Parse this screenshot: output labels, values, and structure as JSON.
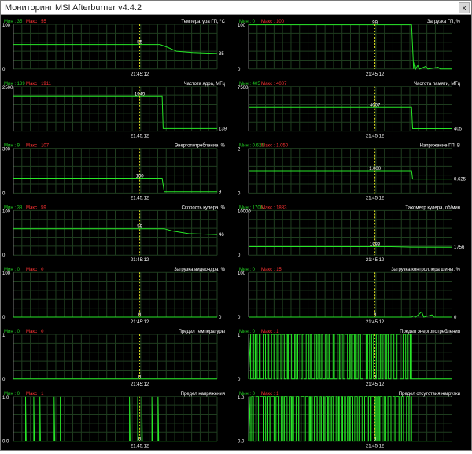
{
  "window": {
    "title": "Мониторинг MSI Afterburner v4.4.2",
    "close_label": "x"
  },
  "cursor_time": "21:45:12",
  "colors": {
    "background": "#000000",
    "grid": "#1f3d1f",
    "line": "#27e627",
    "stats_min": "#22cc22",
    "stats_max": "#ff3333",
    "cursor": "#e0e020",
    "text": "#ffffff"
  },
  "panels": [
    {
      "title": "Температура ГП, °C",
      "min_text": "Мин : 35",
      "max_text": "Макс : 55",
      "y_top": "100",
      "y_bottom": "0",
      "cursor_value": "55",
      "end_value": "35",
      "points": [
        [
          0,
          55
        ],
        [
          0.72,
          55
        ],
        [
          0.76,
          48
        ],
        [
          0.8,
          40
        ],
        [
          0.88,
          37
        ],
        [
          1,
          35
        ]
      ]
    },
    {
      "title": "Загрузка ГП, %",
      "min_text": "Мин : 0",
      "max_text": "Макс : 100",
      "y_top": "100",
      "y_bottom": "0",
      "cursor_value": "99",
      "end_value": "",
      "points": [
        [
          0,
          99
        ],
        [
          0.8,
          99
        ],
        [
          0.81,
          0
        ],
        [
          0.815,
          15
        ],
        [
          0.82,
          0
        ],
        [
          0.83,
          8
        ],
        [
          0.84,
          0
        ],
        [
          0.87,
          6
        ],
        [
          0.88,
          0
        ],
        [
          0.93,
          4
        ],
        [
          0.94,
          0
        ],
        [
          1,
          0
        ]
      ]
    },
    {
      "title": "Частота ядра, МГц",
      "min_text": "Мин : 139",
      "max_text": "Макс : 1911",
      "y_top": "2500",
      "y_bottom": "",
      "cursor_value": "1949",
      "end_value": "139",
      "points": [
        [
          0,
          1949
        ],
        [
          0.73,
          1949
        ],
        [
          0.735,
          139
        ],
        [
          1,
          139
        ]
      ]
    },
    {
      "title": "Частота памяти, МГц",
      "min_text": "Мин : 405",
      "max_text": "Макс : 4007",
      "y_top": "7500",
      "y_bottom": "",
      "cursor_value": "4007",
      "end_value": "405",
      "points": [
        [
          0,
          4007
        ],
        [
          0.8,
          4007
        ],
        [
          0.805,
          405
        ],
        [
          1,
          405
        ]
      ]
    },
    {
      "title": "Энергопотребление, %",
      "min_text": "Мин : 9",
      "max_text": "Макс : 107",
      "y_top": "300",
      "y_bottom": "0",
      "cursor_value": "100",
      "end_value": "9",
      "points": [
        [
          0,
          100
        ],
        [
          0.73,
          100
        ],
        [
          0.74,
          9
        ],
        [
          1,
          9
        ]
      ]
    },
    {
      "title": "Напряжение ГП, В",
      "min_text": "Мин : 0.625",
      "max_text": "Макс : 1.050",
      "y_top": "2",
      "y_bottom": "0",
      "cursor_value": "1.000",
      "end_value": "0.625",
      "points": [
        [
          0,
          1.0
        ],
        [
          0.8,
          1.0
        ],
        [
          0.805,
          0.625
        ],
        [
          1,
          0.625
        ]
      ]
    },
    {
      "title": "Скорость кулера, %",
      "min_text": "Мин : 38",
      "max_text": "Макс : 59",
      "y_top": "100",
      "y_bottom": "0",
      "cursor_value": "59",
      "end_value": "46",
      "points": [
        [
          0,
          59
        ],
        [
          0.74,
          59
        ],
        [
          0.78,
          54
        ],
        [
          0.86,
          48
        ],
        [
          1,
          46
        ]
      ]
    },
    {
      "title": "Тахометр кулера, об/мин",
      "min_text": "Мин : 1706",
      "max_text": "Макс : 1883",
      "y_top": "10000",
      "y_bottom": "0",
      "cursor_value": "1883",
      "end_value": "1756",
      "points": [
        [
          0,
          1883
        ],
        [
          0.7,
          1883
        ],
        [
          0.8,
          1780
        ],
        [
          1,
          1756
        ]
      ]
    },
    {
      "title": "Загрузка видеоядра, %",
      "min_text": "Мин : 0",
      "max_text": "Макс : 0",
      "y_top": "100",
      "y_bottom": "0",
      "cursor_value": "0",
      "end_value": "0",
      "points": [
        [
          0,
          0
        ],
        [
          1,
          0
        ]
      ]
    },
    {
      "title": "Загрузка контроллера шины, %",
      "min_text": "Мин : 0",
      "max_text": "Макс : 15",
      "y_top": "100",
      "y_bottom": "0",
      "cursor_value": "0",
      "end_value": "0",
      "points": [
        [
          0,
          0
        ],
        [
          0.8,
          0
        ],
        [
          0.81,
          3
        ],
        [
          0.82,
          0
        ],
        [
          0.85,
          12
        ],
        [
          0.86,
          0
        ],
        [
          0.9,
          5
        ],
        [
          0.91,
          0
        ],
        [
          1,
          0
        ]
      ]
    },
    {
      "title": "Предел температуры",
      "min_text": "Мин : 0",
      "max_text": "Макс : 0",
      "y_top": "1",
      "y_bottom": "0",
      "cursor_value": "0",
      "end_value": "",
      "points": [
        [
          0,
          0
        ],
        [
          1,
          0
        ]
      ]
    },
    {
      "title": "Предел энергопотребления",
      "min_text": "Мин : 0",
      "max_text": "Макс : 1",
      "y_top": "1",
      "y_bottom": "0",
      "cursor_value": "0",
      "end_value": "",
      "points": [
        [
          0,
          0
        ],
        [
          0.79,
          0
        ],
        [
          0.8,
          0
        ],
        [
          1,
          0
        ]
      ]
    },
    {
      "title": "Предел напряжения",
      "min_text": "Мин : 0",
      "max_text": "Макс : 1",
      "y_top": "1.0",
      "y_bottom": "0.0",
      "cursor_value": "0",
      "end_value": "",
      "points": [
        [
          0,
          0
        ],
        [
          1,
          0
        ]
      ]
    },
    {
      "title": "Предел отсутствия нагрузки",
      "min_text": "Мин : 0",
      "max_text": "Макс : 1",
      "y_top": "1.0",
      "y_bottom": "0.0",
      "cursor_value": "0",
      "end_value": "",
      "points": [
        [
          0,
          0
        ],
        [
          1,
          0
        ]
      ]
    }
  ]
}
